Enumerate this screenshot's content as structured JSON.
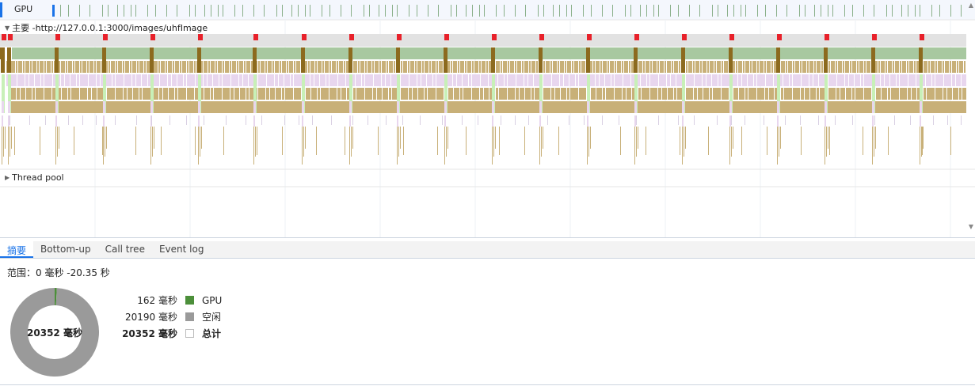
{
  "tracks": {
    "gpu": "GPU",
    "main": "主要 -http://127.0.0.1:3000/images/uhfImage",
    "pool": "Thread pool"
  },
  "tabs": [
    {
      "label": "摘要",
      "active": true
    },
    {
      "label": "Bottom-up",
      "active": false
    },
    {
      "label": "Call tree",
      "active": false
    },
    {
      "label": "Event log",
      "active": false
    }
  ],
  "summary": {
    "range": "范围：0  毫秒 -20.35 秒",
    "total_center": "20352 毫秒",
    "items": [
      {
        "value": "162  毫秒",
        "name": "GPU",
        "color": "#4c8f3a",
        "ms": 162
      },
      {
        "value": "20190  毫秒",
        "name": "空闲",
        "color": "#9a9a9a",
        "ms": 20190
      },
      {
        "value": "20352  毫秒",
        "name": "总计",
        "color": "#ffffff",
        "ms": 20352,
        "bold": true
      }
    ]
  },
  "colors": {
    "gpu": "#4c8f3a",
    "idle": "#9a9a9a",
    "task": "#e2e2e2",
    "script": "#c8b078",
    "script_dark": "#8c6a1e",
    "green": "#a8c8a0",
    "layout": "#e8d6ee",
    "render": "#c8f0b8",
    "accent": "#1a73e8",
    "long_task_marker": "#e8212a"
  }
}
